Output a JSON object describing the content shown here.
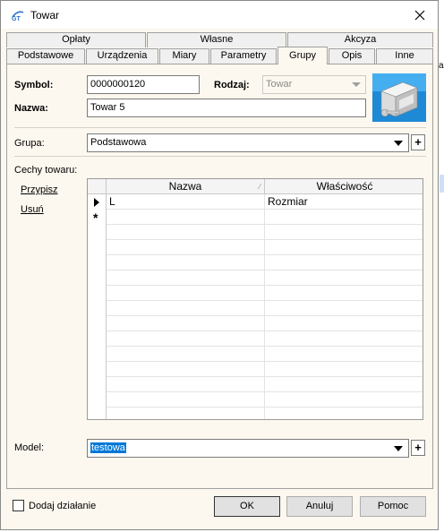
{
  "window": {
    "title": "Towar",
    "close_icon": "close-icon",
    "app_icon": "gt-logo-icon"
  },
  "tabs_row1": [
    {
      "label": "Opłaty"
    },
    {
      "label": "Własne"
    },
    {
      "label": "Akcyza"
    }
  ],
  "tabs_row2": [
    {
      "label": "Podstawowe"
    },
    {
      "label": "Urządzenia"
    },
    {
      "label": "Miary"
    },
    {
      "label": "Parametry"
    },
    {
      "label": "Grupy",
      "active": true
    },
    {
      "label": "Opis"
    },
    {
      "label": "Inne"
    }
  ],
  "form": {
    "symbol_label": "Symbol:",
    "symbol_value": "0000000120",
    "rodzaj_label": "Rodzaj:",
    "rodzaj_value": "Towar",
    "nazwa_label": "Nazwa:",
    "nazwa_value": "Towar 5",
    "grupa_label": "Grupa:",
    "grupa_value": "Podstawowa",
    "cechy_label": "Cechy towaru:",
    "przypisz_link": "Przypisz",
    "usun_link": "Usuń",
    "model_label": "Model:",
    "model_value": "testowa",
    "plus_label": "+"
  },
  "grid": {
    "columns": [
      "Nazwa",
      "Właściwość"
    ],
    "rows": [
      {
        "marker": "current",
        "nazwa": "L",
        "wlasciwosc": "Rozmiar"
      },
      {
        "marker": "new",
        "nazwa": "",
        "wlasciwosc": ""
      }
    ],
    "new_row_marker": "*"
  },
  "footer": {
    "checkbox_label": "Dodaj działanie",
    "checkbox_checked": false,
    "ok_label": "OK",
    "cancel_label": "Anuluj",
    "help_label": "Pomoc"
  },
  "colors": {
    "dialog_bg": "#fdf8ef",
    "selection": "#0078d7"
  }
}
